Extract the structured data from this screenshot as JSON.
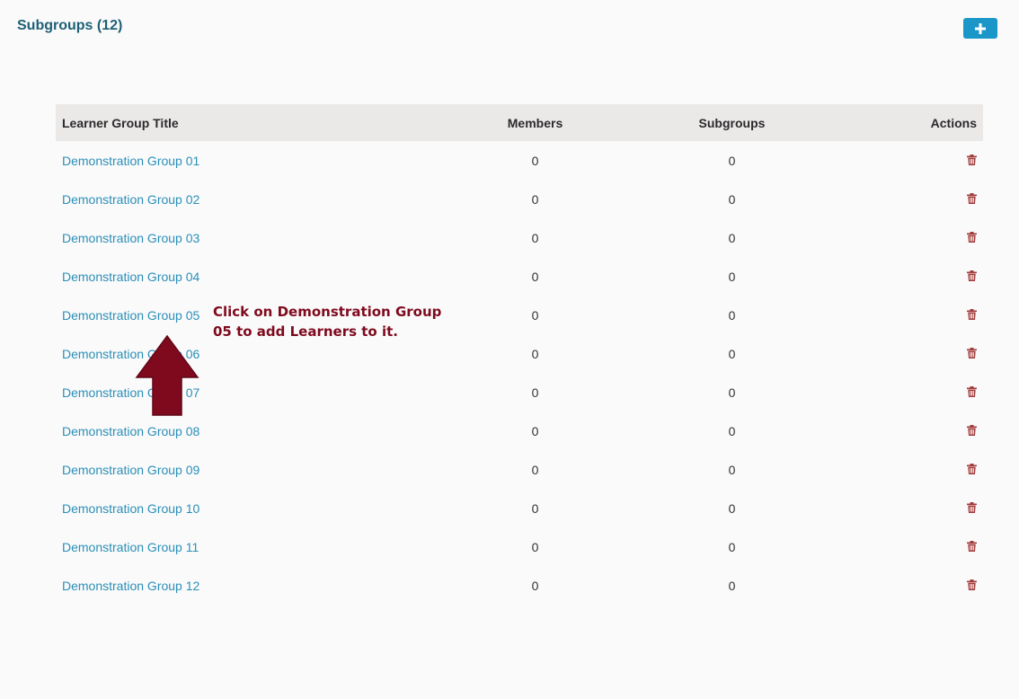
{
  "header": {
    "title": "Subgroups (12)",
    "add_icon": "plus-icon"
  },
  "table": {
    "columns": [
      "Learner Group Title",
      "Members",
      "Subgroups",
      "Actions"
    ],
    "rows": [
      {
        "title": "Demonstration Group 01",
        "members": "0",
        "subgroups": "0"
      },
      {
        "title": "Demonstration Group 02",
        "members": "0",
        "subgroups": "0"
      },
      {
        "title": "Demonstration Group 03",
        "members": "0",
        "subgroups": "0"
      },
      {
        "title": "Demonstration Group 04",
        "members": "0",
        "subgroups": "0"
      },
      {
        "title": "Demonstration Group 05",
        "members": "0",
        "subgroups": "0"
      },
      {
        "title": "Demonstration Group 06",
        "members": "0",
        "subgroups": "0"
      },
      {
        "title": "Demonstration Group 07",
        "members": "0",
        "subgroups": "0"
      },
      {
        "title": "Demonstration Group 08",
        "members": "0",
        "subgroups": "0"
      },
      {
        "title": "Demonstration Group 09",
        "members": "0",
        "subgroups": "0"
      },
      {
        "title": "Demonstration Group 10",
        "members": "0",
        "subgroups": "0"
      },
      {
        "title": "Demonstration Group 11",
        "members": "0",
        "subgroups": "0"
      },
      {
        "title": "Demonstration Group 12",
        "members": "0",
        "subgroups": "0"
      }
    ],
    "action_icon": "trash-icon"
  },
  "annotation": {
    "text": "Click on Demonstration Group 05 to add Learners to it.",
    "arrow_icon": "up-arrow-icon"
  },
  "colors": {
    "title": "#1e5f75",
    "link": "#2a8fb8",
    "button": "#1a96c9",
    "header_row": "#ebe8e8",
    "trash": "#a33b3b",
    "annotation": "#7f0a1e"
  }
}
